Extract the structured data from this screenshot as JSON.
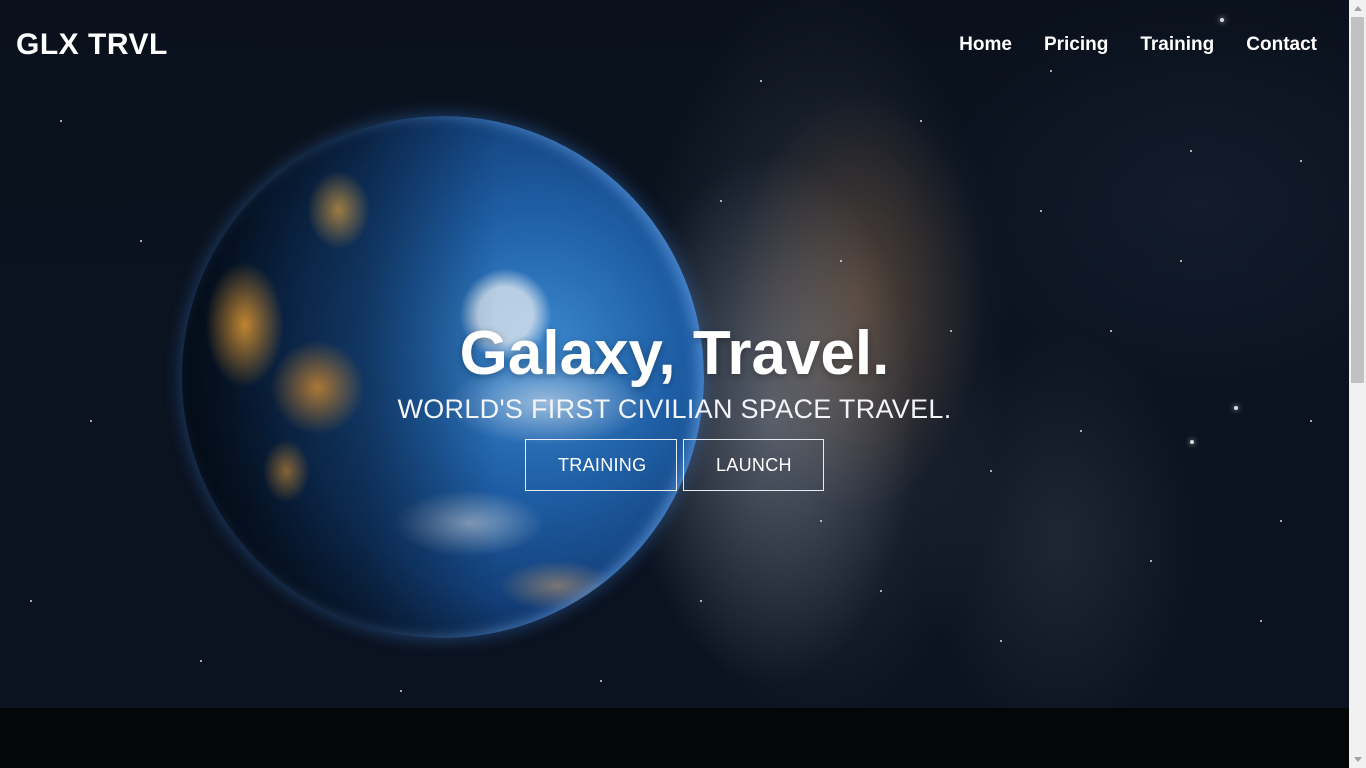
{
  "brand": {
    "name": "GLX TRVL"
  },
  "nav": {
    "items": [
      {
        "label": "Home"
      },
      {
        "label": "Pricing"
      },
      {
        "label": "Training"
      },
      {
        "label": "Contact"
      }
    ]
  },
  "hero": {
    "title": "Galaxy, Travel.",
    "subtitle": "WORLD'S FIRST CIVILIAN SPACE TRAVEL.",
    "buttons": {
      "training": "TRAINING",
      "launch": "LAUNCH"
    }
  },
  "colors": {
    "text": "#ffffff",
    "space_background": "#0b1220",
    "lower_band": "#050608",
    "button_border": "#e8ecf2"
  },
  "icons": {
    "scroll_up": "chevron-up-icon",
    "scroll_down": "chevron-down-icon"
  }
}
